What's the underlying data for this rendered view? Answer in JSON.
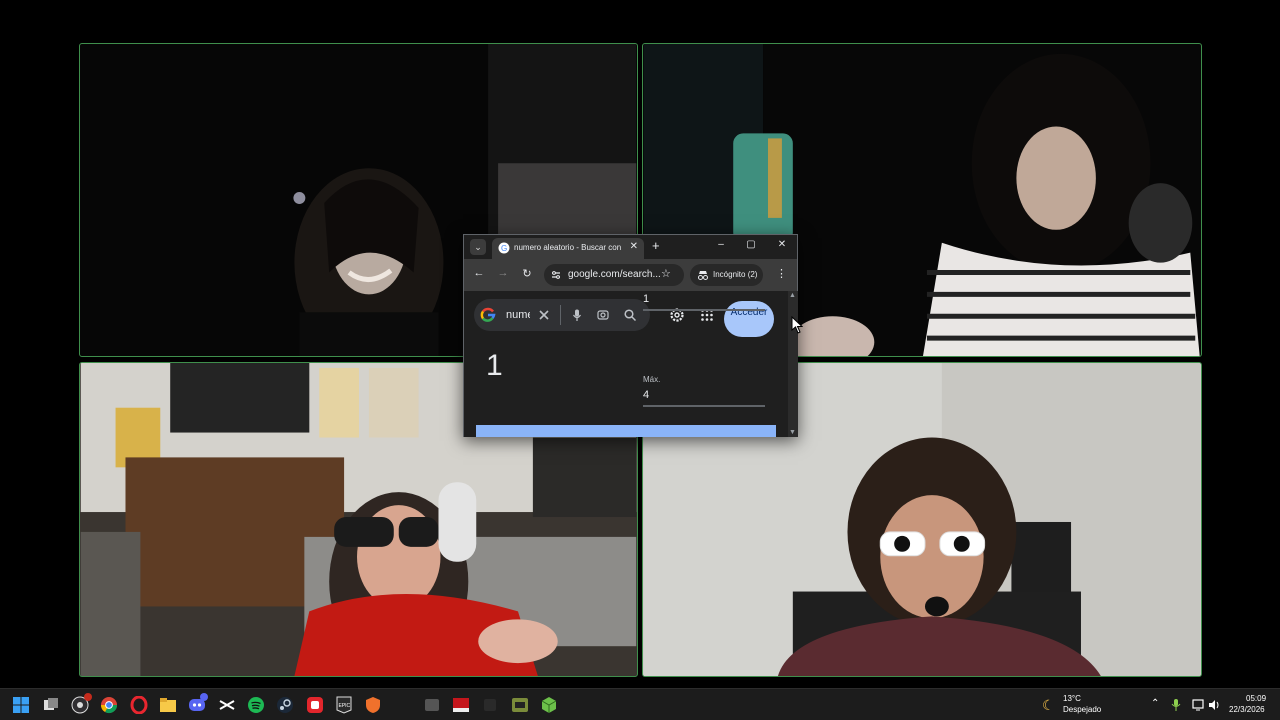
{
  "browser": {
    "tab_title": "numero aleatorio - Buscar con Google",
    "tab_close": "✕",
    "new_tab": "+",
    "window_controls": {
      "minimize": "–",
      "maximize": "▢",
      "close": "✕"
    },
    "tab_menu": "⌄",
    "nav": {
      "back": "←",
      "forward": "→",
      "reload": "↻"
    },
    "url": "google.com/search...",
    "star": "☆",
    "incognito_label": "Incógnito (2)",
    "menu": "⋮",
    "search_query": "numero aleatorio",
    "signin_label": "Acceder",
    "result": "1",
    "min_value": "1",
    "max_label": "Máx.",
    "max_value": "4",
    "scroll_up": "▲",
    "scroll_down": "▼"
  },
  "taskbar": {
    "icons": [
      "windows-start-icon",
      "task-view-icon",
      "obs-icon",
      "chrome-icon",
      "opera-gx-icon",
      "file-explorer-icon",
      "discord-icon",
      "capcut-icon",
      "spotify-icon",
      "steam-icon",
      "app-red-icon",
      "epic-games-icon",
      "browser-shield-icon",
      "app-gray-icon",
      "rec-app-icon",
      "app-dark-icon",
      "app-green-icon",
      "app-cube-icon"
    ],
    "weather_temp": "13°C",
    "weather_desc": "Despejado",
    "time": "05:09",
    "date": "22/3/2026"
  },
  "colors": {
    "tile_border": "#3f8f4c",
    "accent_blue": "#8ab4f8",
    "signin_bg": "#a8c7fa"
  }
}
